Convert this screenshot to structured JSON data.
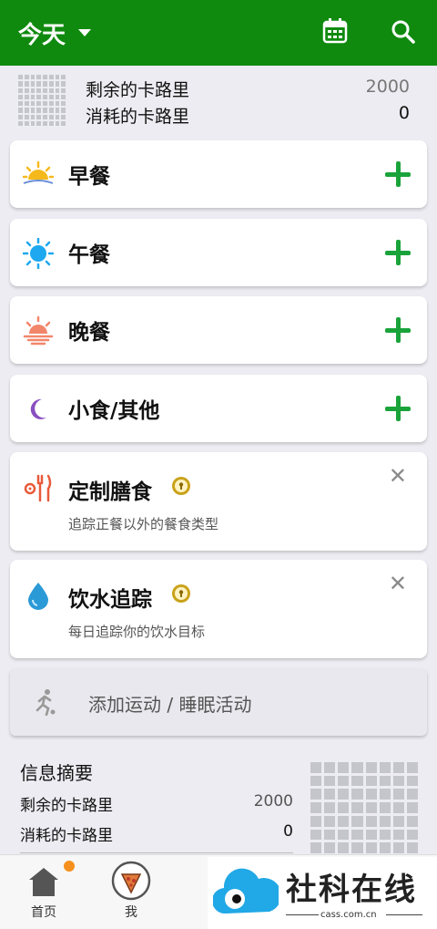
{
  "topbar": {
    "title": "今天",
    "icons": [
      "calendar-icon",
      "search-icon"
    ]
  },
  "summary": {
    "remaining_label": "剩余的卡路里",
    "remaining_value": "2000",
    "burned_label": "消耗的卡路里",
    "burned_value": "0"
  },
  "meals": [
    {
      "label": "早餐",
      "icon": "sunrise-icon"
    },
    {
      "label": "午餐",
      "icon": "sun-icon"
    },
    {
      "label": "晚餐",
      "icon": "sunset-icon"
    },
    {
      "label": "小食/其他",
      "icon": "moon-icon"
    }
  ],
  "features": [
    {
      "label": "定制膳食",
      "desc": "追踪正餐以外的餐食类型",
      "icon": "custom-meal-icon"
    },
    {
      "label": "饮水追踪",
      "desc": "每日追踪你的饮水目标",
      "icon": "water-drop-icon"
    }
  ],
  "exercise": {
    "label": "添加运动 / 睡眠活动"
  },
  "info": {
    "title": "信息摘要",
    "remaining_label": "剩余的卡路里",
    "remaining_value": "2000",
    "burned_label": "消耗的卡路里",
    "burned_value": "0"
  },
  "nav": {
    "home": "首页",
    "me": "我"
  },
  "watermark": {
    "name": "社科在线",
    "url": "cass.com.cn"
  },
  "colors": {
    "header": "#0f8a0f",
    "plus": "#1aa33a",
    "badge": "#f5901e"
  }
}
